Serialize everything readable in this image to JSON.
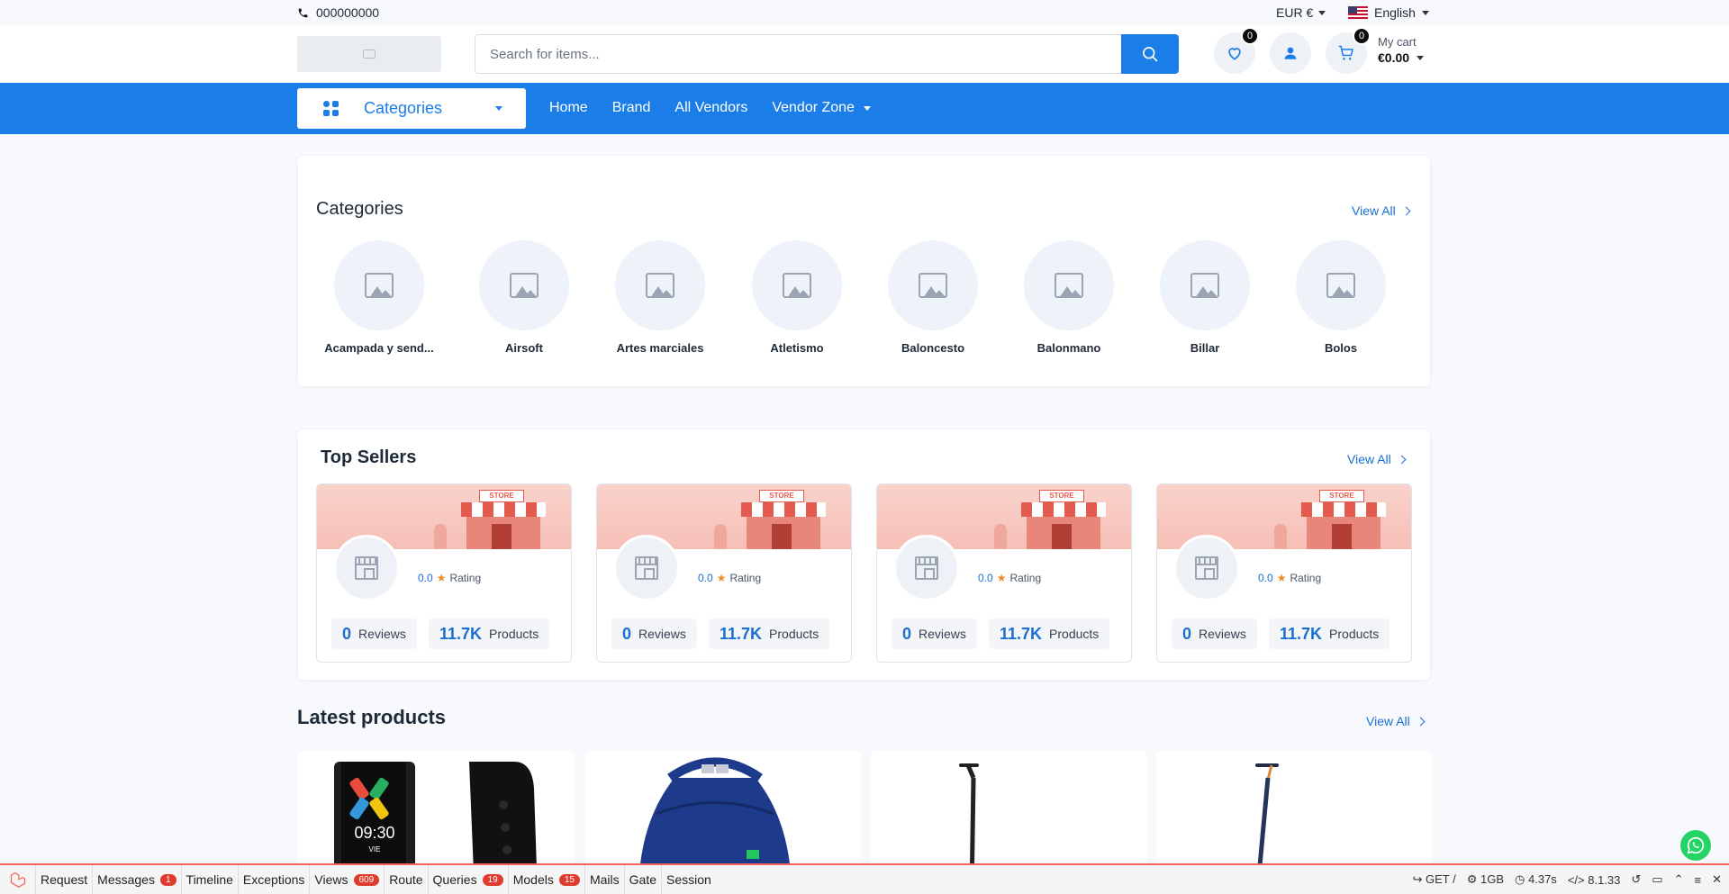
{
  "topbar": {
    "phone": "000000000",
    "currency": "EUR €",
    "language": "English"
  },
  "header": {
    "search_placeholder": "Search for items...",
    "wishlist_count": "0",
    "cart_count": "0",
    "cart_label": "My cart",
    "cart_total": "€0.00"
  },
  "nav": {
    "categories_label": "Categories",
    "links": [
      "Home",
      "Brand",
      "All Vendors"
    ],
    "vendor_zone": "Vendor Zone"
  },
  "categories": {
    "title": "Categories",
    "view_all": "View All",
    "items": [
      "Acampada y send...",
      "Airsoft",
      "Artes marciales",
      "Atletismo",
      "Baloncesto",
      "Balonmano",
      "Billar",
      "Bolos"
    ]
  },
  "top_sellers": {
    "title": "Top Sellers",
    "view_all": "View All",
    "store_sign": "STORE",
    "sellers": [
      {
        "rating": "0.0",
        "rating_label": "Rating",
        "reviews": "0",
        "reviews_label": "Reviews",
        "products": "11.7K",
        "products_label": "Products"
      },
      {
        "rating": "0.0",
        "rating_label": "Rating",
        "reviews": "0",
        "reviews_label": "Reviews",
        "products": "11.7K",
        "products_label": "Products"
      },
      {
        "rating": "0.0",
        "rating_label": "Rating",
        "reviews": "0",
        "reviews_label": "Reviews",
        "products": "11.7K",
        "products_label": "Products"
      },
      {
        "rating": "0.0",
        "rating_label": "Rating",
        "reviews": "0",
        "reviews_label": "Reviews",
        "products": "11.7K",
        "products_label": "Products"
      }
    ]
  },
  "latest_products": {
    "title": "Latest products",
    "view_all": "View All",
    "watch_time": "09:30",
    "watch_day": "VIE"
  },
  "debugbar": {
    "tabs": [
      {
        "label": "Request"
      },
      {
        "label": "Messages",
        "count": "1"
      },
      {
        "label": "Timeline"
      },
      {
        "label": "Exceptions"
      },
      {
        "label": "Views",
        "count": "609"
      },
      {
        "label": "Route"
      },
      {
        "label": "Queries",
        "count": "19"
      },
      {
        "label": "Models",
        "count": "15"
      },
      {
        "label": "Mails"
      },
      {
        "label": "Gate"
      },
      {
        "label": "Session"
      }
    ],
    "method": "GET /",
    "memory": "1GB",
    "time": "4.37s",
    "php": "8.1.33"
  },
  "colors": {
    "primary": "#1a7de8",
    "debug_accent": "#f4645f",
    "whatsapp": "#25d366"
  }
}
